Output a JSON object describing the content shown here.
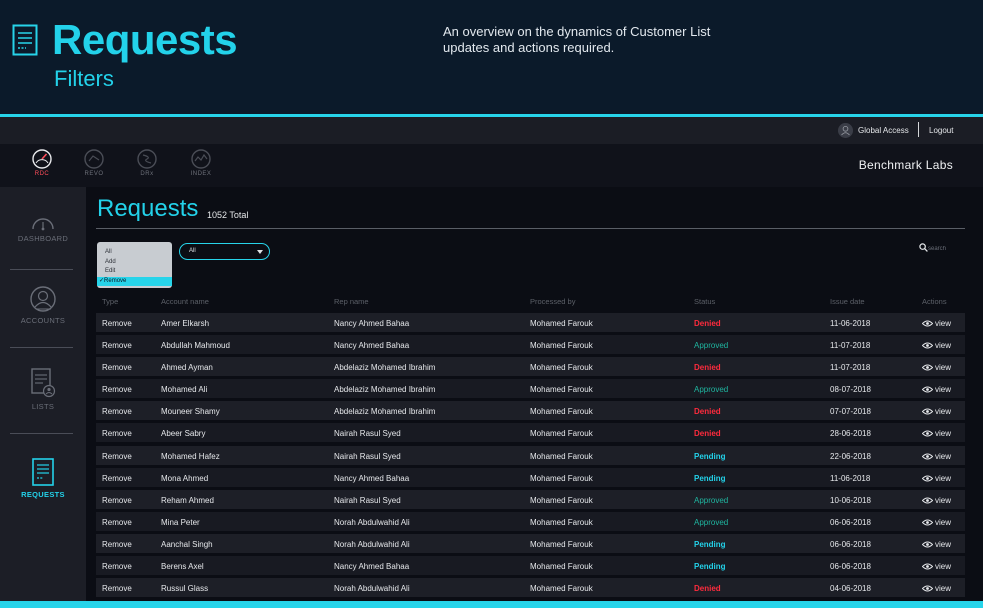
{
  "banner": {
    "title": "Requests",
    "subtitle": "Filters",
    "description": "An overview on the dynamics  of Customer List updates and actions required."
  },
  "topbar": {
    "user_label": "Global Access",
    "logout_label": "Logout"
  },
  "appnav": {
    "items": [
      {
        "label": "RDC",
        "icon": "rdc-gauge-icon",
        "active": true
      },
      {
        "label": "REVO",
        "icon": "revo-icon",
        "active": false
      },
      {
        "label": "DRx",
        "icon": "drx-icon",
        "active": false
      },
      {
        "label": "INDEX",
        "icon": "index-icon",
        "active": false
      }
    ],
    "brand": "Benchmark Labs"
  },
  "sidebar": {
    "items": [
      {
        "label": "DASHBOARD",
        "icon": "dashboard-gauge-icon",
        "active": false
      },
      {
        "label": "ACCOUNTS",
        "icon": "accounts-icon",
        "active": false
      },
      {
        "label": "LISTS",
        "icon": "lists-icon",
        "active": false
      },
      {
        "label": "REQUESTS",
        "icon": "requests-icon",
        "active": true
      }
    ]
  },
  "main": {
    "title": "Requests",
    "total": "1052 Total",
    "type_filter": {
      "options": [
        "All",
        "Add",
        "Edit",
        "Remove"
      ],
      "selected": "Remove",
      "selected_marker": "✓"
    },
    "secondary_filter": {
      "value": "All"
    },
    "search": {
      "placeholder": "search"
    },
    "table": {
      "columns": [
        "Type",
        "Account name",
        "Rep name",
        "Processed by",
        "Status",
        "Issue date",
        "Actions"
      ],
      "action_label": "view",
      "rows": [
        {
          "type": "Remove",
          "account": "Amer Elkarsh",
          "rep": "Nancy Ahmed Bahaa",
          "processed": "Mohamed Farouk",
          "status": "Denied",
          "date": "11-06-2018"
        },
        {
          "type": "Remove",
          "account": "Abdullah Mahmoud",
          "rep": "Nancy Ahmed Bahaa",
          "processed": "Mohamed Farouk",
          "status": "Approved",
          "date": "11-07-2018"
        },
        {
          "type": "Remove",
          "account": "Ahmed Ayman",
          "rep": "Abdelaziz Mohamed Ibrahim",
          "processed": "Mohamed Farouk",
          "status": "Denied",
          "date": "11-07-2018"
        },
        {
          "type": "Remove",
          "account": "Mohamed Ali",
          "rep": "Abdelaziz Mohamed Ibrahim",
          "processed": "Mohamed Farouk",
          "status": "Approved",
          "date": "08-07-2018"
        },
        {
          "type": "Remove",
          "account": "Mouneer Shamy",
          "rep": "Abdelaziz Mohamed Ibrahim",
          "processed": "Mohamed Farouk",
          "status": "Denied",
          "date": "07-07-2018"
        },
        {
          "type": "Remove",
          "account": "Abeer Sabry",
          "rep": "Nairah Rasul Syed",
          "processed": "Mohamed Farouk",
          "status": "Denied",
          "date": "28-06-2018"
        },
        {
          "type": "Remove",
          "account": "Mohamed Hafez",
          "rep": "Nairah Rasul Syed",
          "processed": "Mohamed Farouk",
          "status": "Pending",
          "date": "22-06-2018"
        },
        {
          "type": "Remove",
          "account": "Mona Ahmed",
          "rep": "Nancy Ahmed Bahaa",
          "processed": "Mohamed Farouk",
          "status": "Pending",
          "date": "11-06-2018"
        },
        {
          "type": "Remove",
          "account": "Reham Ahmed",
          "rep": "Nairah Rasul Syed",
          "processed": "Mohamed Farouk",
          "status": "Approved",
          "date": "10-06-2018"
        },
        {
          "type": "Remove",
          "account": "Mina Peter",
          "rep": "Norah Abdulwahid Ali",
          "processed": "Mohamed Farouk",
          "status": "Approved",
          "date": "06-06-2018"
        },
        {
          "type": "Remove",
          "account": "Aanchal Singh",
          "rep": "Norah Abdulwahid Ali",
          "processed": "Mohamed Farouk",
          "status": "Pending",
          "date": "06-06-2018"
        },
        {
          "type": "Remove",
          "account": "Berens Axel",
          "rep": "Nancy Ahmed Bahaa",
          "processed": "Mohamed Farouk",
          "status": "Pending",
          "date": "06-06-2018"
        },
        {
          "type": "Remove",
          "account": "Russul Glass",
          "rep": "Norah Abdulwahid Ali",
          "processed": "Mohamed Farouk",
          "status": "Denied",
          "date": "04-06-2018"
        }
      ]
    }
  },
  "colors": {
    "accent": "#27d4ea",
    "denied": "#ff2b3d",
    "approved": "#1fb6a0",
    "pending": "#23d2ea"
  }
}
